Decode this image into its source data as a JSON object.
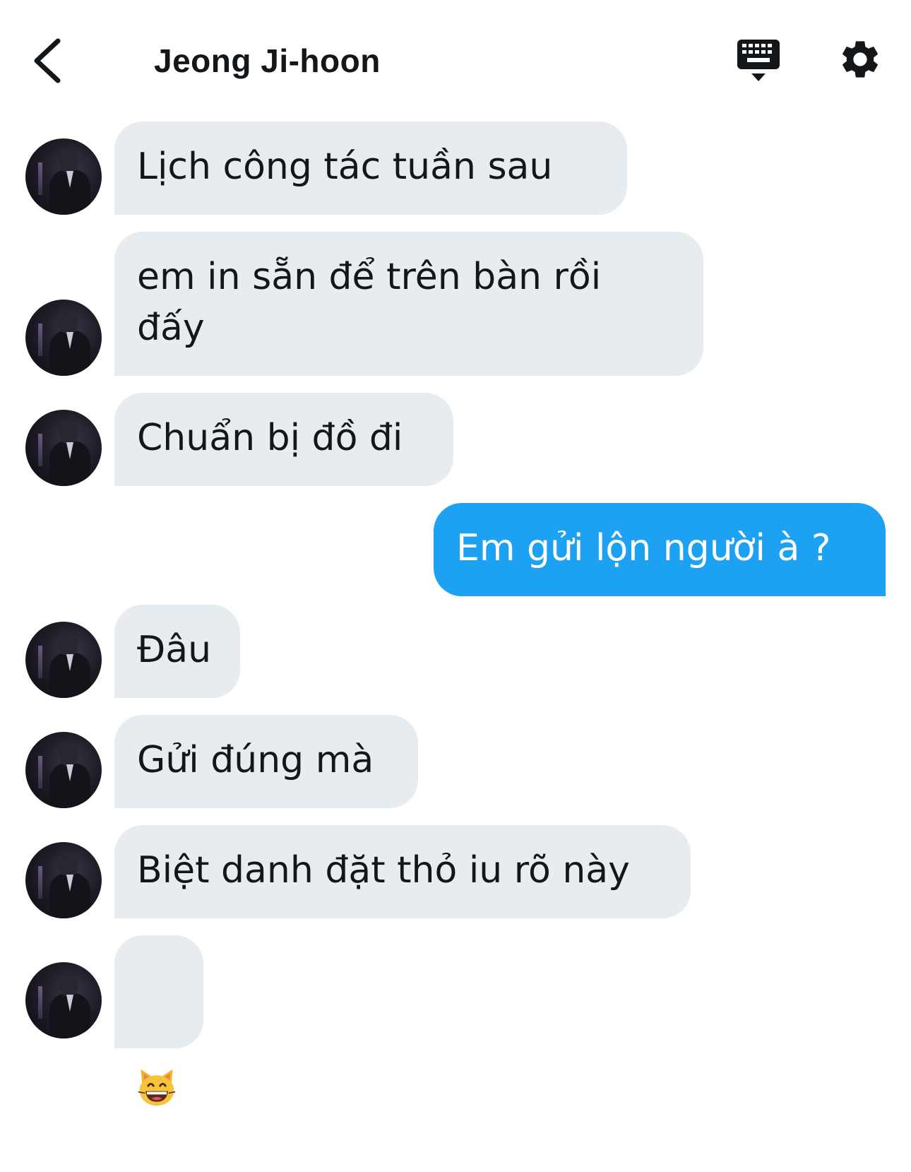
{
  "header": {
    "title": "Jeong Ji-hoon",
    "icons": {
      "back": "chevron-left-icon",
      "keyboard": "keyboard-icon",
      "settings": "gear-icon"
    }
  },
  "colors": {
    "incoming_bubble": "#e6ecf0",
    "outgoing_bubble": "#1da1f2",
    "text": "#14171a"
  },
  "messages": [
    {
      "direction": "incoming",
      "text": "Lịch công tác tuần sau"
    },
    {
      "direction": "incoming",
      "text": "em in sẵn để trên bàn rồi\nđấy"
    },
    {
      "direction": "incoming",
      "text": "Chuẩn bị đồ đi"
    },
    {
      "direction": "outgoing",
      "text": "Em gửi lộn người à ?"
    },
    {
      "direction": "incoming",
      "text": "Đâu"
    },
    {
      "direction": "incoming",
      "text": "Gửi đúng mà"
    },
    {
      "direction": "incoming",
      "text": "Biệt danh đặt thỏ iu rõ này"
    },
    {
      "direction": "incoming",
      "emoji": "grinning-cat-emoji"
    }
  ]
}
